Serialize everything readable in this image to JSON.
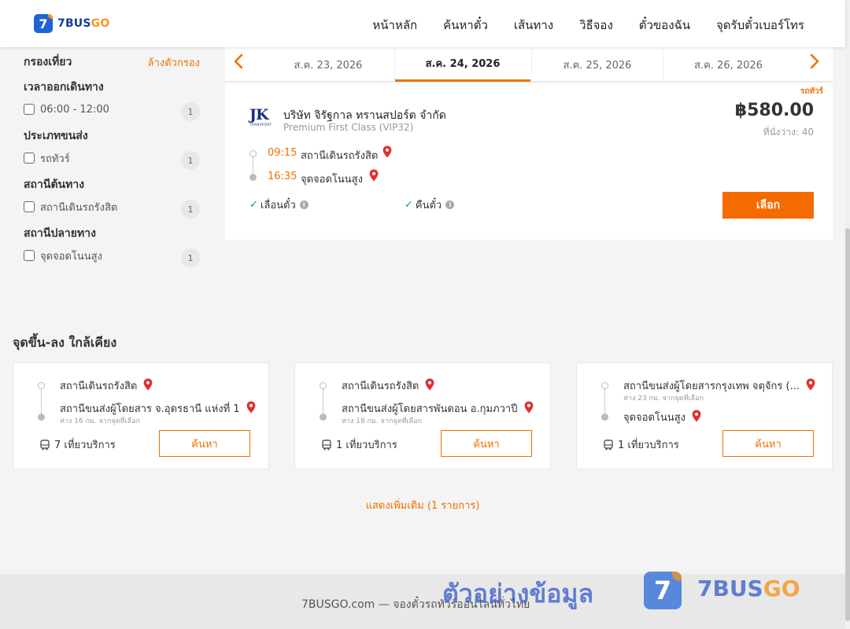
{
  "brand": {
    "logo_mark": "7",
    "name_main": "7BUS",
    "name_accent": "GO",
    "blue": "#1e62d6",
    "orange": "#f7941d"
  },
  "nav": {
    "items": [
      "หน้าหลัก",
      "ค้นหาตั๋ว",
      "เส้นทาง",
      "วิธีจอง",
      "ตั๋วของฉัน",
      "จุดรับตั๋วเบอร์โทร"
    ]
  },
  "filters": {
    "title": "กรองเที่ยว",
    "clear_label": "ล้างตัวกรอง",
    "groups": [
      {
        "title": "เวลาออกเดินทาง",
        "option": "06:00 - 12:00",
        "count": "1"
      },
      {
        "title": "ประเภทขนส่ง",
        "option": "รถทัวร์",
        "count": "1"
      },
      {
        "title": "สถานีต้นทาง",
        "option": "สถานีเดินรถรังสิต",
        "count": "1"
      },
      {
        "title": "สถานีปลายทาง",
        "option": "จุดจอดโนนสูง",
        "count": "1"
      }
    ]
  },
  "dates": {
    "tabs": [
      "ส.ค. 23, 2026",
      "ส.ค. 24, 2026",
      "ส.ค. 25, 2026",
      "ส.ค. 26, 2026"
    ],
    "active_index": 1,
    "prev_icon": "chevron-left-icon",
    "next_icon": "chevron-right-icon"
  },
  "trip": {
    "ribbon": "รถทัวร์",
    "operator_logo": "JK",
    "operator_logo_sub": "TRANSPORT",
    "operator_name": "บริษัท จิรัฐกาล ทรานสปอร์ต จำกัด",
    "class": "Premium First Class (VIP32)",
    "price": "฿580.00",
    "seats": "ที่นั่งว่าง: 40",
    "depart_time": "09:15",
    "depart_station": "สถานีเดินรถรังสิต",
    "arrive_time": "16:35",
    "arrive_station": "จุดจอดโนนสูง",
    "feature_1": "เลื่อนตั๋ว",
    "feature_2": "คืนตั๋ว",
    "select_label": "เลือก"
  },
  "nearby": {
    "title": "จุดขึ้น-ลง ใกล้เคียง",
    "cards": [
      {
        "from": "สถานีเดินรถรังสิต",
        "from_note": "",
        "to": "สถานีขนส่งผู้โดยสาร จ.อุดรธานี แห่งที่ 1",
        "to_note": "ห่าง 16 กม. จากจุดที่เลือก",
        "trips": "7 เที่ยวบริการ",
        "button": "ค้นหา"
      },
      {
        "from": "สถานีเดินรถรังสิต",
        "from_note": "",
        "to": "สถานีขนส่งผู้โดยสารพันดอน อ.กุมภวาปี",
        "to_note": "ห่าง 18 กม. จากจุดที่เลือก",
        "trips": "1 เที่ยวบริการ",
        "button": "ค้นหา"
      },
      {
        "from": "สถานีขนส่งผู้โดยสารกรุงเทพ จตุจักร (...",
        "from_note": "ห่าง 23 กม. จากจุดที่เลือก",
        "to": "จุดจอดโนนสูง",
        "to_note": "",
        "trips": "1 เที่ยวบริการ",
        "button": "ค้นหา"
      }
    ],
    "more_label": "แสดงเพิ่มเติม (1 รายการ)"
  },
  "footer": {
    "text": "7BUSGO.com — จองตั๋วรถทัวร์ออนไลน์ทั่วไทย",
    "watermark": "ตัวอย่างข้อมูล",
    "wm_logo_mark": "7",
    "wm_name_main": "7BUS",
    "wm_name_accent": "GO"
  }
}
